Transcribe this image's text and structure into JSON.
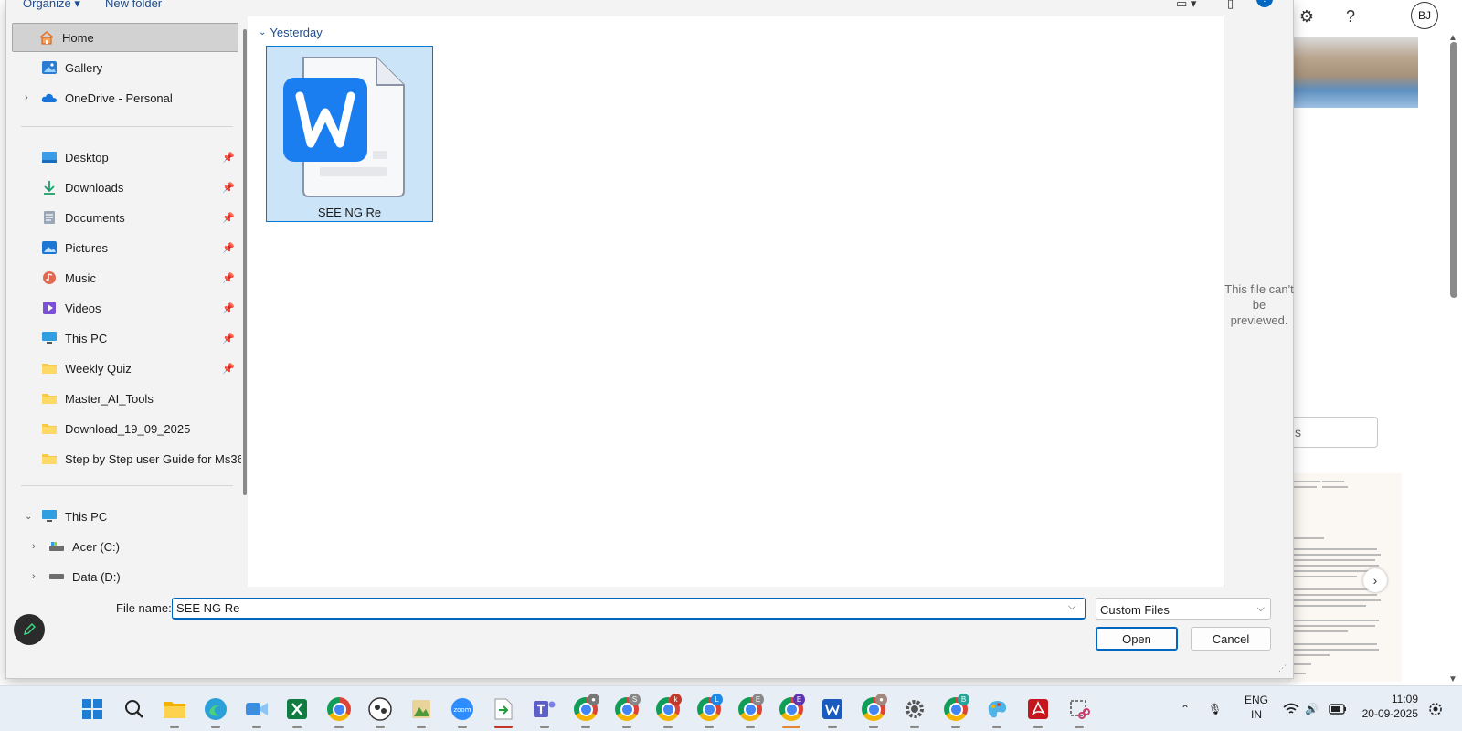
{
  "dialog": {
    "toolbar": {
      "organize": "Organize",
      "new_folder": "New folder",
      "help": "?"
    },
    "nav": {
      "items": [
        {
          "label": "Home",
          "icon": "home-icon",
          "selected": true
        },
        {
          "label": "Gallery",
          "icon": "gallery-icon"
        },
        {
          "label": "OneDrive - Personal",
          "icon": "onedrive-icon",
          "expandable": true
        },
        {
          "label": "Desktop",
          "icon": "desktop-icon",
          "pinned": true
        },
        {
          "label": "Downloads",
          "icon": "downloads-icon",
          "pinned": true
        },
        {
          "label": "Documents",
          "icon": "documents-icon",
          "pinned": true
        },
        {
          "label": "Pictures",
          "icon": "pictures-icon",
          "pinned": true
        },
        {
          "label": "Music",
          "icon": "music-icon",
          "pinned": true
        },
        {
          "label": "Videos",
          "icon": "videos-icon",
          "pinned": true
        },
        {
          "label": "This PC",
          "icon": "this-pc-icon",
          "pinned": true
        },
        {
          "label": "Weekly Quiz",
          "icon": "folder-icon",
          "pinned": true
        },
        {
          "label": "Master_AI_Tools",
          "icon": "folder-icon"
        },
        {
          "label": "Download_19_09_2025",
          "icon": "folder-icon"
        },
        {
          "label": "Step by Step user Guide for Ms365",
          "icon": "folder-icon"
        },
        {
          "label": "This PC",
          "icon": "this-pc-icon",
          "expanded": true
        },
        {
          "label": "Acer (C:)",
          "icon": "drive-icon",
          "expandable": true
        },
        {
          "label": "Data (D:)",
          "icon": "drive-icon",
          "expandable": true
        }
      ]
    },
    "files": {
      "group_label": "Yesterday",
      "items": [
        {
          "name": "SEE NG Re",
          "icon": "wps-writer-icon",
          "selected": true
        }
      ]
    },
    "preview": {
      "message": "This file can't be previewed."
    },
    "bottom": {
      "file_name_label": "File name:",
      "file_name_value": "SEE NG Re",
      "file_type": "Custom Files",
      "open_label": "Open",
      "cancel_label": "Cancel"
    }
  },
  "background_app": {
    "avatar_initials": "BJ",
    "search_fragment": "s"
  },
  "taskbar": {
    "language": {
      "line1": "ENG",
      "line2": "IN"
    },
    "clock": {
      "time": "11:09",
      "date": "20-09-2025"
    },
    "badges": {
      "teams_s": "S",
      "chrome_k": "k",
      "chrome_l": "L",
      "chrome_e1": "E",
      "chrome_e2": "E",
      "chrome_b": "B"
    }
  },
  "colors": {
    "accent": "#0067c0",
    "selection": "#cce4f7",
    "taskbar": "#e8eef6"
  }
}
